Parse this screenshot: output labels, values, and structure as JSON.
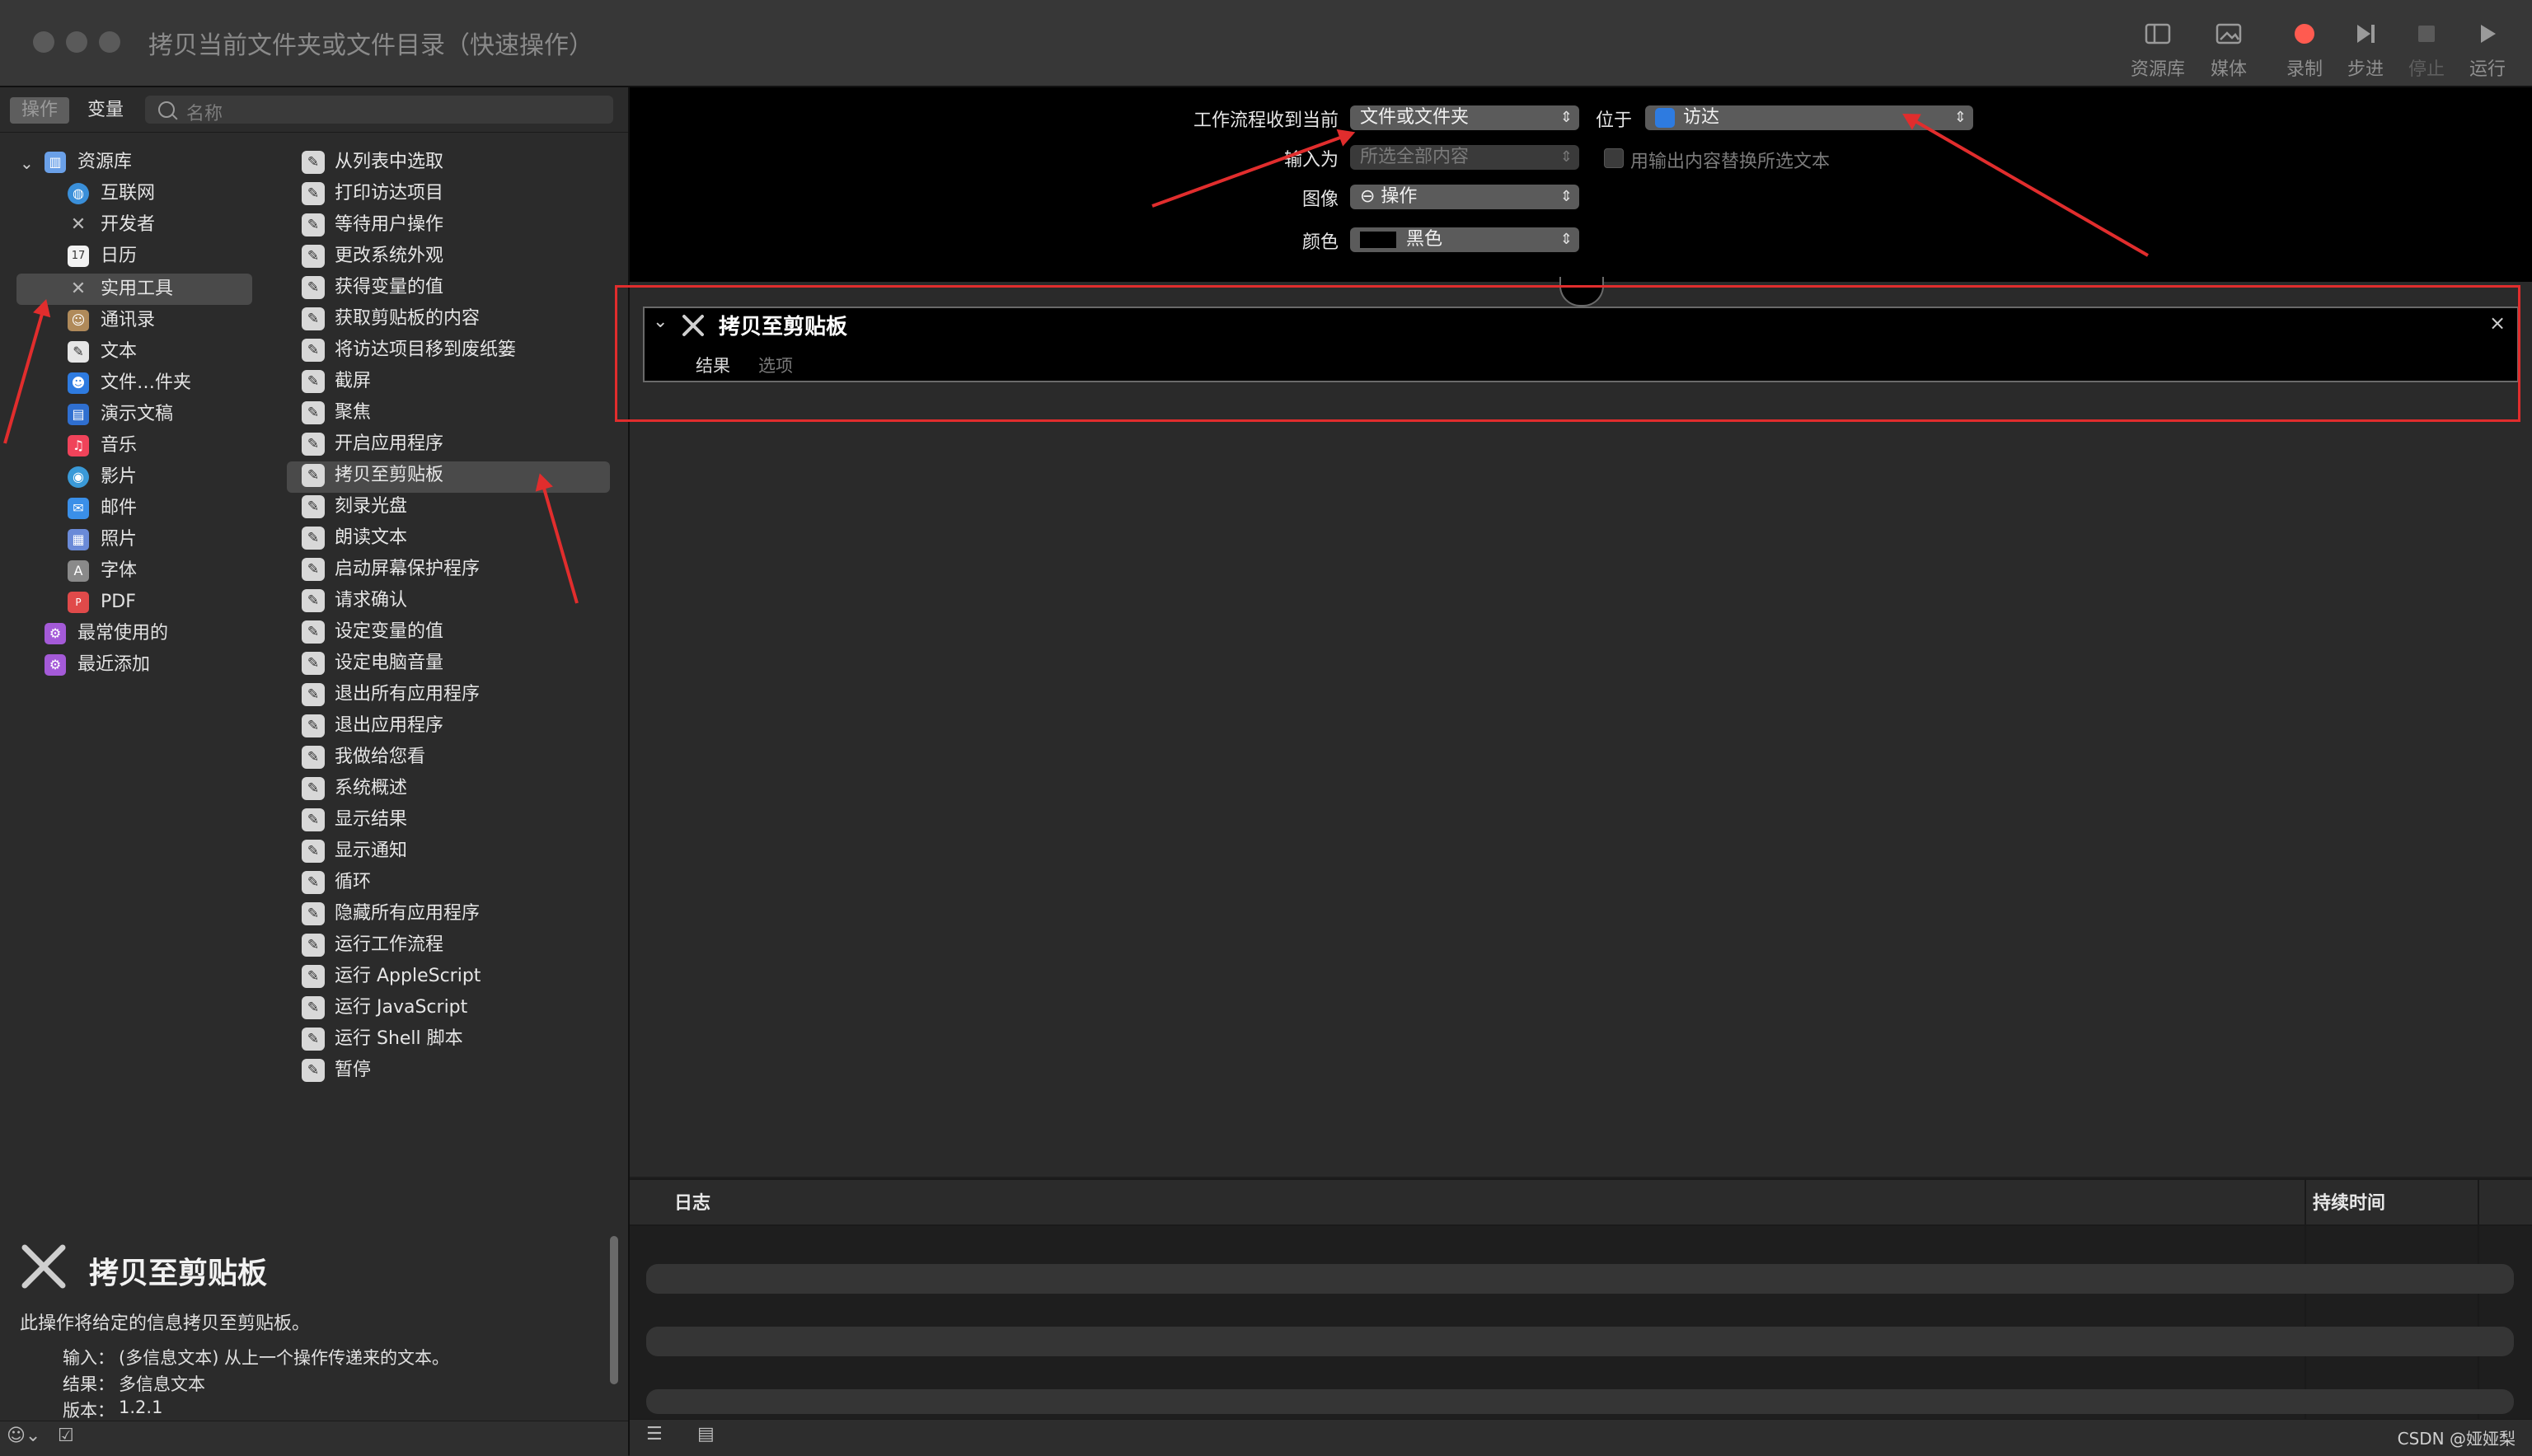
{
  "window": {
    "title": "拷贝当前文件夹或文件目录（快速操作）",
    "toolbar": [
      {
        "label": "资源库",
        "icon": "library-icon"
      },
      {
        "label": "媒体",
        "icon": "media-icon"
      },
      {
        "label": "录制",
        "icon": "record-icon"
      },
      {
        "label": "步进",
        "icon": "step-icon"
      },
      {
        "label": "停止",
        "icon": "stop-icon"
      },
      {
        "label": "运行",
        "icon": "run-icon"
      }
    ]
  },
  "left": {
    "segments": [
      "操作",
      "变量"
    ],
    "search_placeholder": "名称",
    "library": [
      {
        "label": "资源库",
        "icon": "library-icon",
        "color": "#6aa0e8"
      },
      {
        "label": "互联网",
        "icon": "globe-icon",
        "color": "#3a8fd9"
      },
      {
        "label": "开发者",
        "icon": "tools-icon",
        "color": "#888888"
      },
      {
        "label": "日历",
        "icon": "calendar-icon",
        "color": "#e04a3a"
      },
      {
        "label": "实用工具",
        "icon": "tools-icon",
        "color": "#888888"
      },
      {
        "label": "通讯录",
        "icon": "contacts-icon",
        "color": "#b08a5a"
      },
      {
        "label": "文本",
        "icon": "text-icon",
        "color": "#cccccc"
      },
      {
        "label": "文件…件夹",
        "icon": "finder-icon",
        "color": "#2e7be0"
      },
      {
        "label": "演示文稿",
        "icon": "keynote-icon",
        "color": "#2f6fd0"
      },
      {
        "label": "音乐",
        "icon": "music-icon",
        "color": "#f0435a"
      },
      {
        "label": "影片",
        "icon": "movie-icon",
        "color": "#3a9ad8"
      },
      {
        "label": "邮件",
        "icon": "mail-icon",
        "color": "#3a8fe8"
      },
      {
        "label": "照片",
        "icon": "photos-icon",
        "color": "#6a8ad8"
      },
      {
        "label": "字体",
        "icon": "fonts-icon",
        "color": "#888888"
      },
      {
        "label": "PDF",
        "icon": "pdf-icon",
        "color": "#e04a4a"
      },
      {
        "label": "最常使用的",
        "icon": "folder-purple-icon",
        "color": "#a45ad8"
      },
      {
        "label": "最近添加",
        "icon": "folder-purple-icon",
        "color": "#a45ad8"
      }
    ],
    "actions": [
      "从列表中选取",
      "打印访达项目",
      "等待用户操作",
      "更改系统外观",
      "获得变量的值",
      "获取剪贴板的内容",
      "将访达项目移到废纸篓",
      "截屏",
      "聚焦",
      "开启应用程序",
      "拷贝至剪贴板",
      "刻录光盘",
      "朗读文本",
      "启动屏幕保护程序",
      "请求确认",
      "设定变量的值",
      "设定电脑音量",
      "退出所有应用程序",
      "退出应用程序",
      "我做给您看",
      "系统概述",
      "显示结果",
      "显示通知",
      "循环",
      "隐藏所有应用程序",
      "运行工作流程",
      "运行 AppleScript",
      "运行 JavaScript",
      "运行 Shell 脚本",
      "暂停"
    ],
    "description": {
      "title": "拷贝至剪贴板",
      "summary": "此操作将给定的信息拷贝至剪贴板。",
      "input_label": "输入：",
      "input_value": "(多信息文本) 从上一个操作传递来的文本。",
      "result_label": "结果：",
      "result_value": "多信息文本",
      "version_label": "版本：",
      "version_value": "1.2.1"
    }
  },
  "config": {
    "receives_label": "工作流程收到当前",
    "receives_value": "文件或文件夹",
    "in_label": "位于",
    "in_value": "访达",
    "input_is_label": "输入为",
    "input_is_value": "所选全部内容",
    "replace_label": "用输出内容替换所选文本",
    "image_label": "图像",
    "image_value": "⊖ 操作",
    "color_label": "颜色",
    "color_value": "黑色"
  },
  "action_card": {
    "title": "拷贝至剪贴板",
    "tabs": [
      "结果",
      "选项"
    ]
  },
  "log": {
    "col_log": "日志",
    "col_duration": "持续时间"
  },
  "watermark": "CSDN @娅娅梨",
  "colors": {
    "accent_red": "#e12d2d",
    "record": "#ff5b50"
  }
}
